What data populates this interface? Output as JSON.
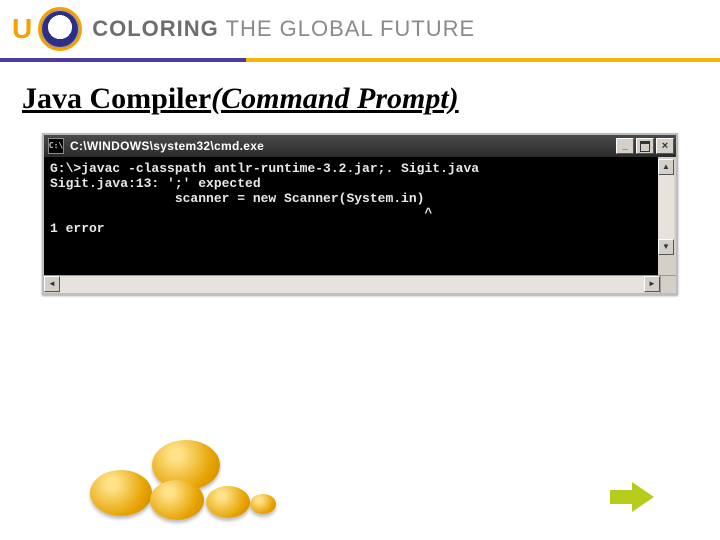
{
  "banner": {
    "logo_letter": "U",
    "tagline_strong": "COLORING",
    "tagline_rest": " THE GLOBAL FUTURE"
  },
  "slide": {
    "title_plain": "Java Compiler ",
    "title_italic": "(Command Prompt)"
  },
  "cmd": {
    "titlebar_icon_text": "C:\\",
    "titlebar_text": "C:\\WINDOWS\\system32\\cmd.exe",
    "min_label": "_",
    "close_label": "×",
    "lines": [
      "G:\\>javac -classpath antlr-runtime-3.2.jar;. Sigit.java",
      "Sigit.java:13: ';' expected",
      "                scanner = new Scanner(System.in)",
      "                                                ^",
      "1 error",
      ""
    ],
    "scroll": {
      "up": "▲",
      "down": "▼",
      "left": "◄",
      "right": "►"
    }
  },
  "nav": {
    "next_name": "next-arrow"
  }
}
